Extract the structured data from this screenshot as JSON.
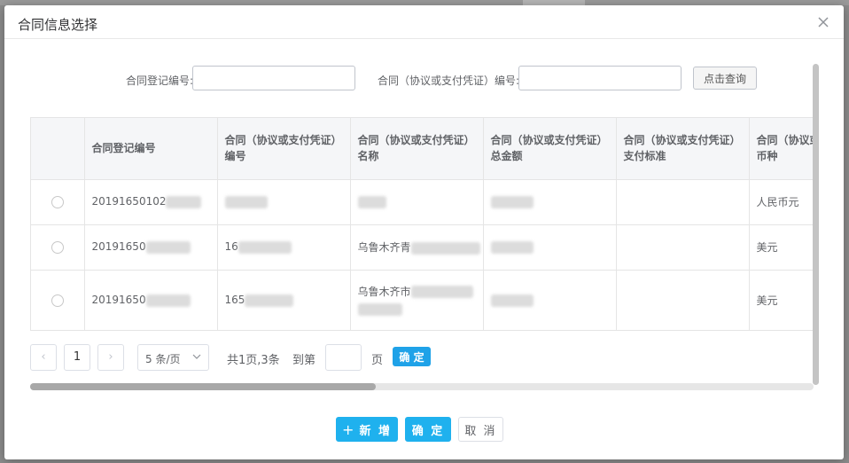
{
  "dialog": {
    "title": "合同信息选择"
  },
  "search": {
    "reg_no_label": "合同登记编号:",
    "reg_no_value": "",
    "contract_no_label": "合同（协议或支付凭证）编号:",
    "contract_no_value": "",
    "query_label": "点击查询"
  },
  "table": {
    "headers": [
      "",
      "合同登记编号",
      "合同（协议或支付凭证）编号",
      "合同（协议或支付凭证）名称",
      "合同（协议或支付凭证）总金额",
      "合同（协议或支付凭证）支付标准",
      "合同（协议或支付凭证）币种"
    ],
    "rows": [
      {
        "reg_no": "20191650102",
        "contract_no": "",
        "name": "",
        "amount": "",
        "standard": "",
        "currency": "人民币元"
      },
      {
        "reg_no": "20191650",
        "contract_no": "16",
        "name": "乌鲁木齐青",
        "amount": "",
        "standard": "",
        "currency": "美元"
      },
      {
        "reg_no": "20191650",
        "contract_no": "165",
        "name": "乌鲁木齐市",
        "amount": "",
        "standard": "",
        "currency": "美元"
      }
    ]
  },
  "pager": {
    "current_page": "1",
    "page_size": "5 条/页",
    "summary": "共1页,3条",
    "goto_label": "到第",
    "page_unit": "页",
    "confirm_label": "确 定"
  },
  "footer": {
    "add_label": "新 增",
    "ok_label": "确 定",
    "cancel_label": "取 消"
  },
  "colors": {
    "primary": "#1fb1ee",
    "pager_confirm": "#1fa2e8",
    "header_bg": "#f5f6f8"
  }
}
